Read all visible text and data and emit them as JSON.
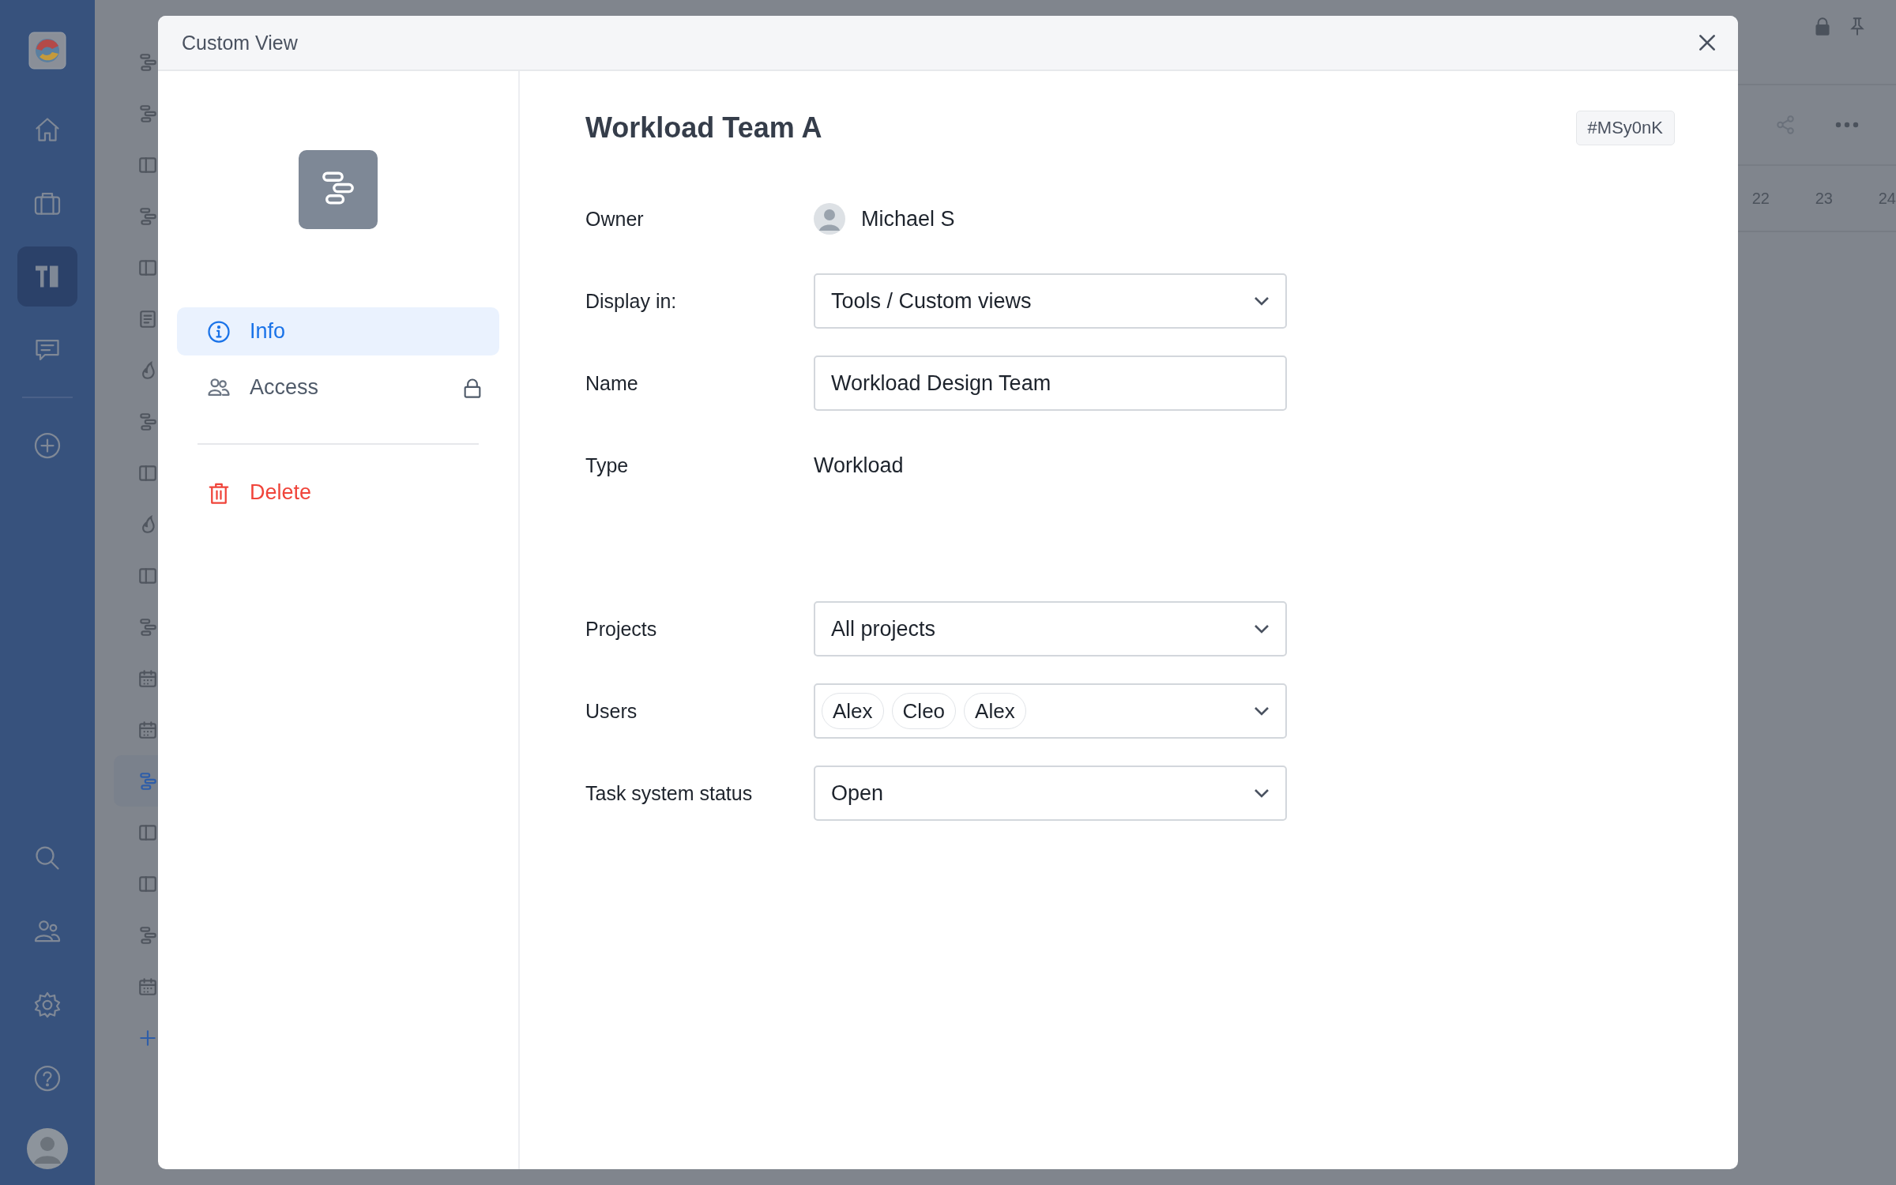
{
  "nav_items": [
    {
      "kind": "home",
      "selected": false
    },
    {
      "kind": "briefcase",
      "selected": false
    },
    {
      "kind": "tools",
      "selected": true
    },
    {
      "kind": "chat",
      "selected": false
    },
    {
      "kind": "add",
      "selected": false
    }
  ],
  "nav_bottom": [
    {
      "kind": "search",
      "selected": false
    },
    {
      "kind": "users",
      "selected": false
    },
    {
      "kind": "settings",
      "selected": false
    },
    {
      "kind": "help",
      "selected": false
    }
  ],
  "views": [
    {
      "kind": "gantt",
      "selected": false
    },
    {
      "kind": "gantt",
      "selected": false
    },
    {
      "kind": "board",
      "selected": false
    },
    {
      "kind": "gantt",
      "selected": false
    },
    {
      "kind": "board",
      "selected": false
    },
    {
      "kind": "doc",
      "selected": false
    },
    {
      "kind": "fire",
      "selected": false
    },
    {
      "kind": "gantt",
      "selected": false
    },
    {
      "kind": "board",
      "selected": false
    },
    {
      "kind": "fire",
      "selected": false
    },
    {
      "kind": "board",
      "selected": false
    },
    {
      "kind": "gantt",
      "selected": false
    },
    {
      "kind": "calendar",
      "selected": false
    },
    {
      "kind": "calendar",
      "selected": false
    },
    {
      "kind": "gantt",
      "selected": true
    },
    {
      "kind": "board",
      "selected": false
    },
    {
      "kind": "board",
      "selected": false
    },
    {
      "kind": "gantt",
      "selected": false
    },
    {
      "kind": "calendar",
      "selected": false
    }
  ],
  "timeline": {
    "days": [
      "22",
      "23",
      "24"
    ]
  },
  "modal": {
    "title": "Custom View",
    "menu": [
      {
        "kind": "info",
        "label": "Info",
        "selected": true,
        "locked": false
      },
      {
        "kind": "access",
        "label": "Access",
        "selected": false,
        "locked": true
      }
    ],
    "delete_label": "Delete",
    "heading": "Workload Team A",
    "id_badge": "#MSy0nK",
    "fields": [
      {
        "kind": "user",
        "label": "Owner",
        "value": "Michael S"
      },
      {
        "kind": "select",
        "label": "Display in:",
        "value": "Tools / Custom views"
      },
      {
        "kind": "input",
        "label": "Name",
        "value": "Workload Design Team"
      },
      {
        "kind": "text",
        "label": "Type",
        "value": "Workload"
      }
    ],
    "filters": [
      {
        "kind": "select",
        "label": "Projects",
        "value": "All projects"
      },
      {
        "kind": "chips",
        "label": "Users",
        "values": [
          "Alex",
          "Cleo",
          "Alex"
        ]
      },
      {
        "kind": "select",
        "label": "Task system status",
        "value": "Open"
      }
    ]
  }
}
